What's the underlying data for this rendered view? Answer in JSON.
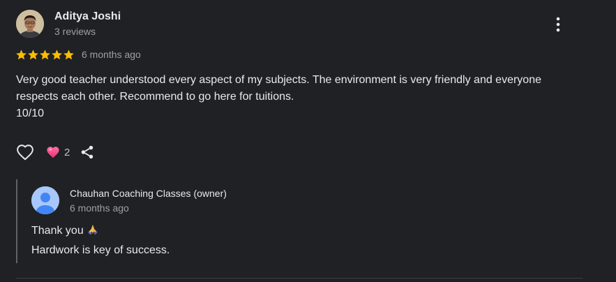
{
  "reviewer": {
    "name": "Aditya Joshi",
    "reviews_count": "3 reviews"
  },
  "rating": {
    "stars": 5,
    "max_stars": 5,
    "time": "6 months ago",
    "star_color": "#fbbc04"
  },
  "review": {
    "line1": "Very good teacher understood every aspect of my subjects. The environment is very friendly and everyone respects each other. Recommend to go here for tuitions.",
    "line2": "10/10"
  },
  "actions": {
    "like_icon": "heart-outline-icon",
    "reaction_icon": "heart-emoji-icon",
    "reaction_count": "2",
    "share_icon": "share-icon"
  },
  "owner_reply": {
    "name": "Chauhan Coaching Classes (owner)",
    "time": "6 months ago",
    "line1": "Thank you",
    "line1_emoji": "folded-hands-emoji",
    "line2": "Hardwork is key of success."
  },
  "colors": {
    "background": "#202124",
    "text": "#e8eaed",
    "secondary_text": "#9aa0a6",
    "owner_avatar": "#a8c7fa"
  }
}
